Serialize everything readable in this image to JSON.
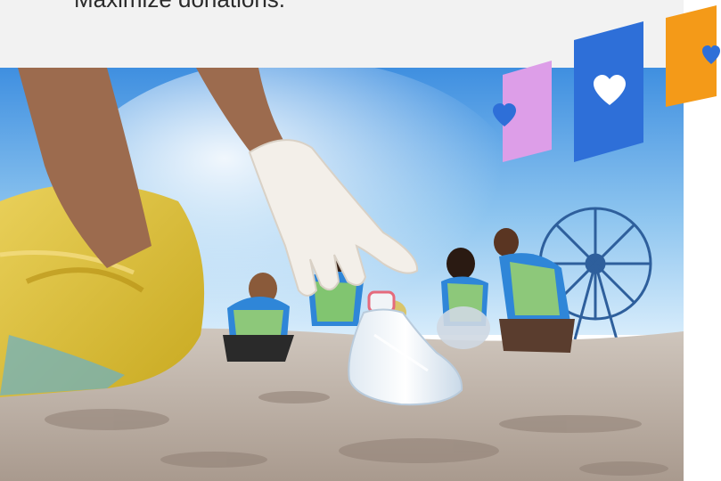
{
  "header": {
    "headline_fragment": "Maximize donations."
  },
  "hero_image": {
    "subject": "Volunteers collecting plastic waste on a sandy beach; gloved hand picking up a plastic bottle; ferris wheel in the background"
  },
  "decorations": {
    "colors": {
      "pink": "#dd9ee8",
      "blue": "#2e6fd8",
      "orange": "#f49a18",
      "heart_blue": "#2e6fd8",
      "heart_white": "#ffffff"
    },
    "icons": [
      "heart-icon",
      "heart-icon",
      "heart-icon"
    ]
  }
}
